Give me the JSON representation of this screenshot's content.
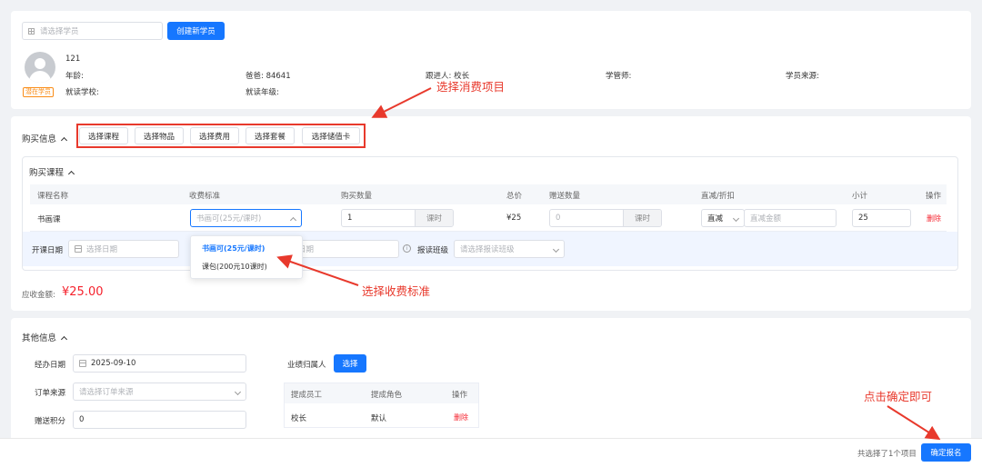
{
  "student": {
    "search_placeholder": "请选择学员",
    "create_button": "创建新学员",
    "name": "121",
    "status_tag": "潜在学员",
    "age_label": "年龄:",
    "school_label": "就读学校:",
    "parent": "爸爸: 84641",
    "grade_label": "就读年级:",
    "follower": "跟进人: 校长",
    "manager_label": "学管师:",
    "source_label": "学员来源:"
  },
  "purchase": {
    "section_title": "购买信息",
    "buttons": [
      "选择课程",
      "选择物品",
      "选择费用",
      "选择套餐",
      "选择储值卡"
    ],
    "course_title": "购买课程",
    "headers": [
      "课程名称",
      "收费标准",
      "购买数量",
      "总价",
      "赠送数量",
      "直减/折扣",
      "小计",
      "操作"
    ],
    "row": {
      "course": "书画课",
      "fee_value": "书画可(25元/课时)",
      "quantity": "1",
      "quantity_unit": "课时",
      "total": "¥25",
      "gift_qty": "0",
      "gift_unit": "课时",
      "discount_type": "直减",
      "discount_placeholder": "直减金额",
      "subtotal": "25",
      "delete": "删除"
    },
    "start_date_label": "开课日期",
    "start_date_placeholder": "选择日期",
    "end_date_placeholder": "日期",
    "class_label": "报读班级",
    "class_placeholder": "请选择报读班级",
    "dropdown_options": [
      "书画可(25元/课时)",
      "课包(200元10课时)"
    ],
    "receivable_label": "应收金额:",
    "receivable_value": "¥25.00"
  },
  "other": {
    "section_title": "其他信息",
    "date_label": "经办日期",
    "date_value": "2025-09-10",
    "source_label": "订单来源",
    "source_placeholder": "请选择订单来源",
    "points_label": "赠送积分",
    "points_value": "0",
    "perf_label": "业绩归属人",
    "perf_button": "选择",
    "table_headers": [
      "提成员工",
      "提成角色",
      "操作"
    ],
    "table_row": [
      "校长",
      "默认",
      "删除"
    ]
  },
  "footer": {
    "selected_text": "共选择了1个项目",
    "confirm_button": "确定报名"
  },
  "annotations": {
    "select_items": "选择消费项目",
    "select_fee": "选择收费标准",
    "confirm": "点击确定即可"
  },
  "colors": {
    "primary": "#1677ff",
    "annotation_red": "#e8392c",
    "danger": "#f5222d",
    "tag_orange": "#fa8c16"
  }
}
